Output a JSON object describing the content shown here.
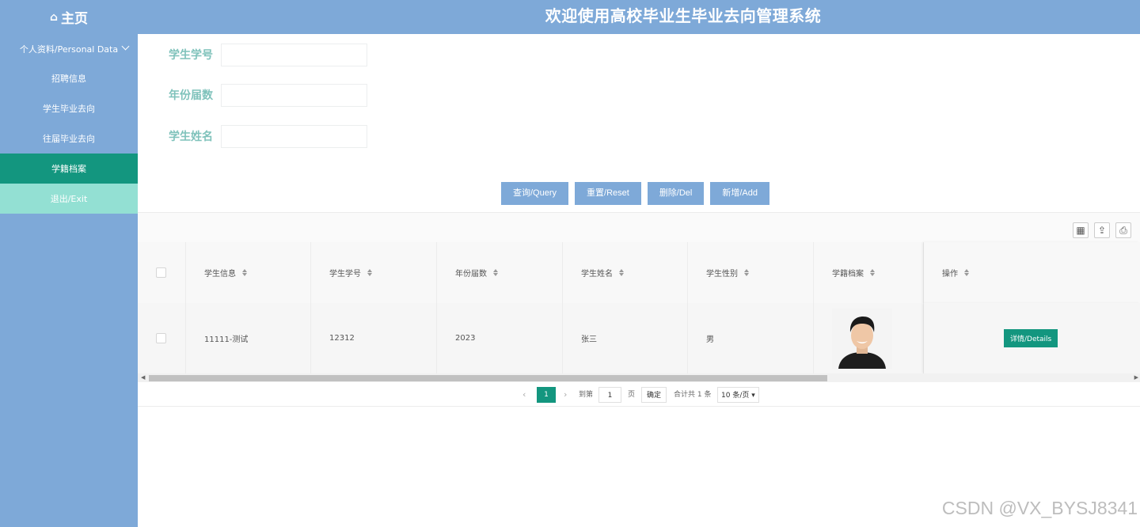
{
  "header": {
    "home_icon": "house-icon",
    "home_label": "主页",
    "title": "欢迎使用高校毕业生毕业去向管理系统"
  },
  "sidebar": {
    "items": [
      {
        "label": "个人资料/Personal Data"
      },
      {
        "label": "招聘信息"
      },
      {
        "label": "学生毕业去向"
      },
      {
        "label": "往届毕业去向"
      },
      {
        "label": "学籍档案"
      },
      {
        "label": "退出/Exit"
      }
    ]
  },
  "search": {
    "student_no_label": "学生学号",
    "year_label": "年份届数",
    "name_label": "学生姓名",
    "student_no_value": "",
    "year_value": "",
    "name_value": ""
  },
  "buttons": {
    "query": "查询/Query",
    "reset": "重置/Reset",
    "delete": "删除/Del",
    "add": "新增/Add"
  },
  "toolbar": {
    "icons": [
      "columns-icon",
      "export-icon",
      "print-icon"
    ]
  },
  "table": {
    "headers": [
      "学生信息",
      "学生学号",
      "年份届数",
      "学生姓名",
      "学生性别",
      "学籍档案",
      "操作"
    ],
    "rows": [
      {
        "info": "11111-测试",
        "student_no": "12312",
        "year": "2023",
        "name": "张三",
        "gender": "男",
        "detail_label": "详情/Details"
      }
    ]
  },
  "pagination": {
    "current_page": "1",
    "goto_label": "到第",
    "goto_value": "1",
    "page_unit": "页",
    "confirm": "确定",
    "total": "合计共 1 条",
    "page_size": "10 条/页"
  },
  "watermark": "CSDN @VX_BYSJ8341",
  "colors": {
    "primary": "#7ea9d8",
    "accent": "#13967f",
    "exit": "#93e0d3"
  }
}
